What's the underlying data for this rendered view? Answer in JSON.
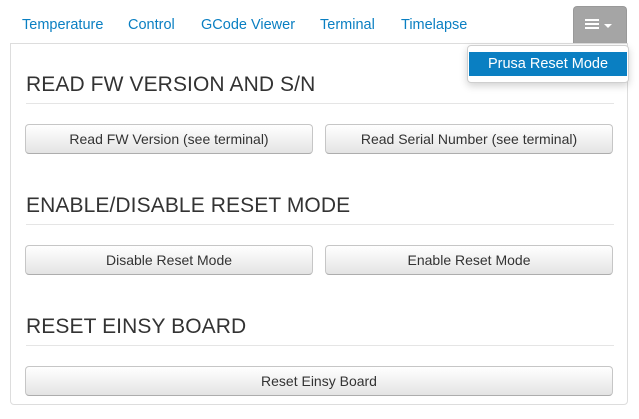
{
  "tabs": {
    "items": [
      {
        "label": "Temperature"
      },
      {
        "label": "Control"
      },
      {
        "label": "GCode Viewer"
      },
      {
        "label": "Terminal"
      },
      {
        "label": "Timelapse"
      }
    ],
    "more_menu_icon": "hamburger-menu-icon",
    "dropdown_items": [
      {
        "label": "Prusa Reset Mode"
      }
    ]
  },
  "sections": [
    {
      "title": "READ FW VERSION AND S/N",
      "buttons": [
        {
          "label": "Read FW Version (see terminal)"
        },
        {
          "label": "Read Serial Number (see terminal)"
        }
      ]
    },
    {
      "title": "ENABLE/DISABLE RESET MODE",
      "buttons": [
        {
          "label": "Disable Reset Mode"
        },
        {
          "label": "Enable Reset Mode"
        }
      ]
    },
    {
      "title": "RESET EINSY BOARD",
      "buttons": [
        {
          "label": "Reset Einsy Board"
        }
      ]
    }
  ],
  "colors": {
    "link": "#0a7fc2",
    "active_menu_item": "#0a7fc2",
    "more_tab": "#a5a5a5"
  }
}
